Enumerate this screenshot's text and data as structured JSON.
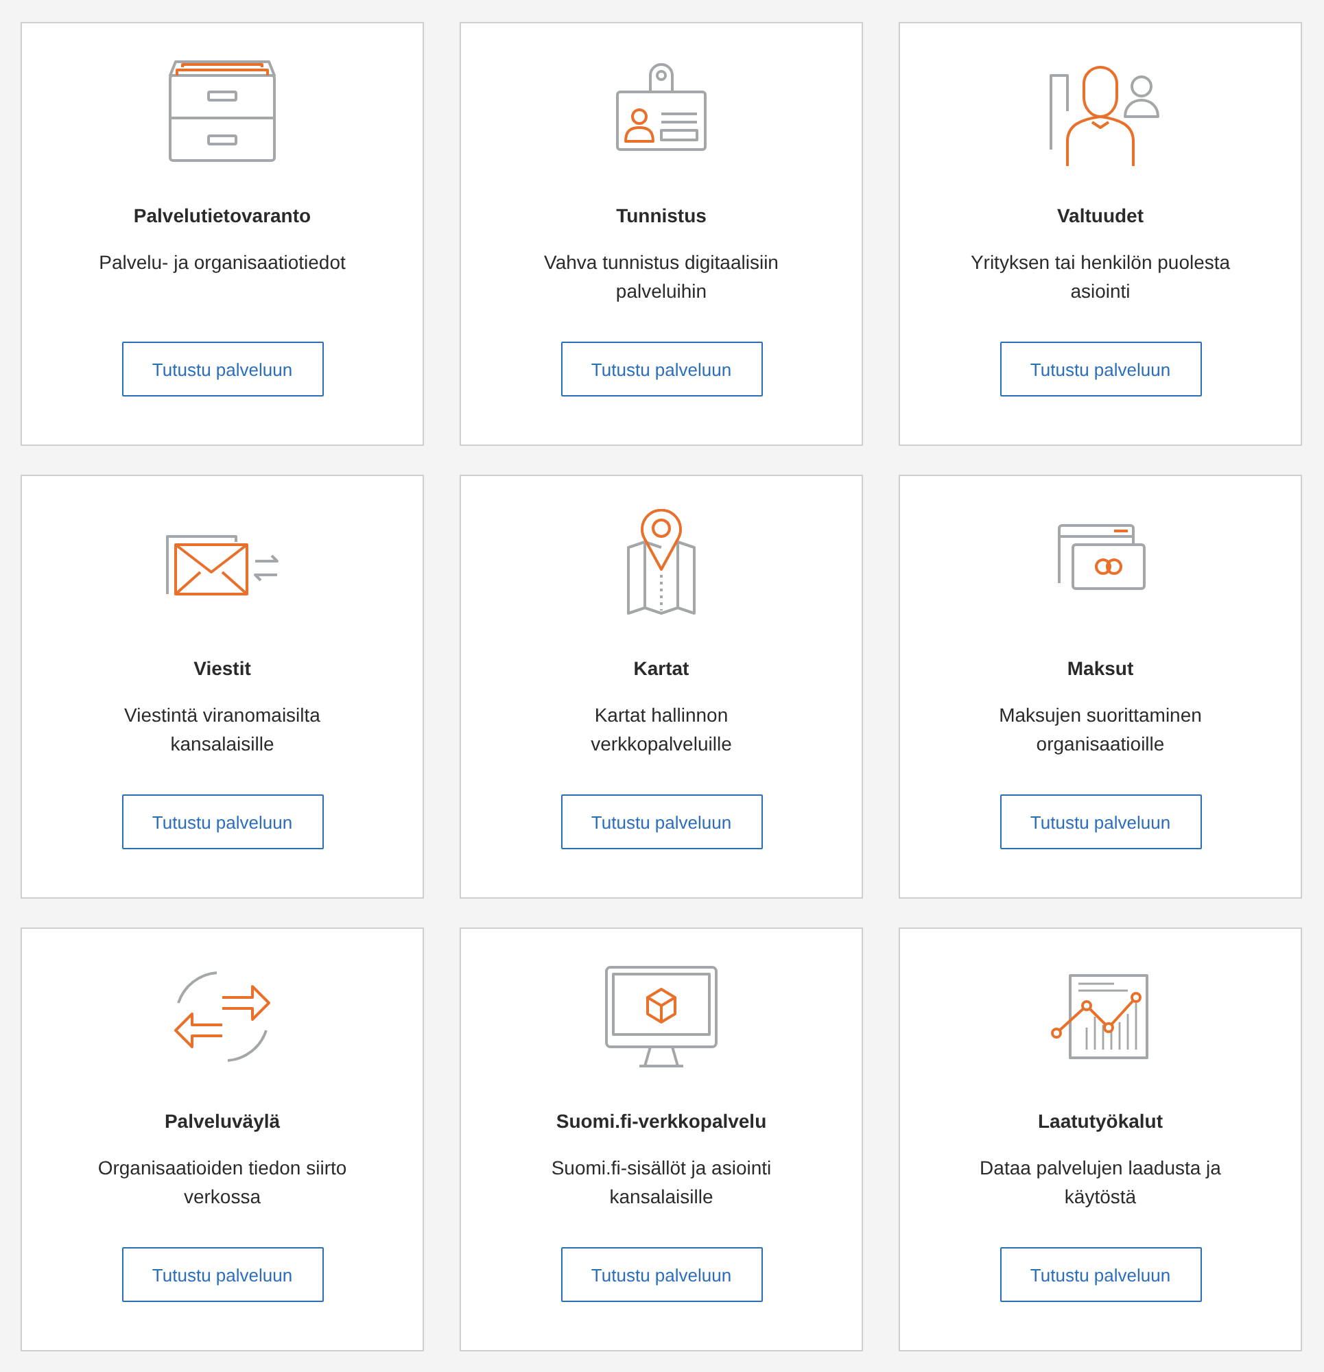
{
  "services": [
    {
      "title": "Palvelutietovaranto",
      "description": "Palvelu- ja organisaatiotiedot",
      "button": "Tutustu palveluun"
    },
    {
      "title": "Tunnistus",
      "description": "Vahva tunnistus digitaalisiin palveluihin",
      "button": "Tutustu palveluun"
    },
    {
      "title": "Valtuudet",
      "description": "Yrityksen tai henkilön puolesta asiointi",
      "button": "Tutustu palveluun"
    },
    {
      "title": "Viestit",
      "description": "Viestintä viranomaisilta kansalaisille",
      "button": "Tutustu palveluun"
    },
    {
      "title": "Kartat",
      "description": "Kartat hallinnon verkkopalveluille",
      "button": "Tutustu palveluun"
    },
    {
      "title": "Maksut",
      "description": "Maksujen suorittaminen organisaatioille",
      "button": "Tutustu palveluun"
    },
    {
      "title": "Palveluväylä",
      "description": "Organisaatioiden tiedon siirto verkossa",
      "button": "Tutustu palveluun"
    },
    {
      "title": "Suomi.fi-verkkopalvelu",
      "description": "Suomi.fi-sisällöt ja asiointi kansalaisille",
      "button": "Tutustu palveluun"
    },
    {
      "title": "Laatutyökalut",
      "description": "Dataa palvelujen laadusta ja käytöstä",
      "button": "Tutustu palveluun"
    }
  ]
}
